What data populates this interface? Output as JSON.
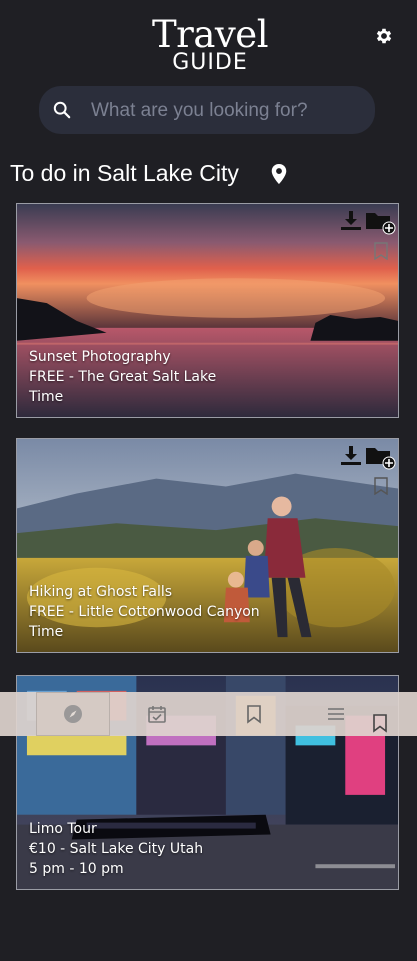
{
  "header": {
    "logo_line1": "Travel",
    "logo_line2": "GUIDE",
    "settings_icon": "gear-icon"
  },
  "search": {
    "placeholder": "What are you looking for?",
    "value": "",
    "icon": "search-icon"
  },
  "section": {
    "title": "To do in Salt Lake City",
    "icon": "location-pin-icon"
  },
  "cards": [
    {
      "title": "Sunset Photography",
      "subtitle": "FREE - The Great Salt Lake",
      "time": "Time"
    },
    {
      "title": "Hiking at Ghost Falls",
      "subtitle": "FREE - Little Cottonwood Canyon",
      "time": "Time"
    },
    {
      "title": "Limo Tour",
      "subtitle": "€10 - Salt Lake City Utah",
      "time": "5 pm - 10 pm"
    }
  ],
  "tabbar": {
    "tabs": [
      {
        "icon": "compass-icon",
        "active": true
      },
      {
        "icon": "calendar-check-icon",
        "active": false
      },
      {
        "icon": "bookmark-icon",
        "active": false
      },
      {
        "icon": "menu-icon",
        "active": false
      }
    ]
  },
  "colors": {
    "background": "#1f1f24",
    "search_bg": "#2b2e3b",
    "tabbar_bg": "#ded4ce"
  }
}
